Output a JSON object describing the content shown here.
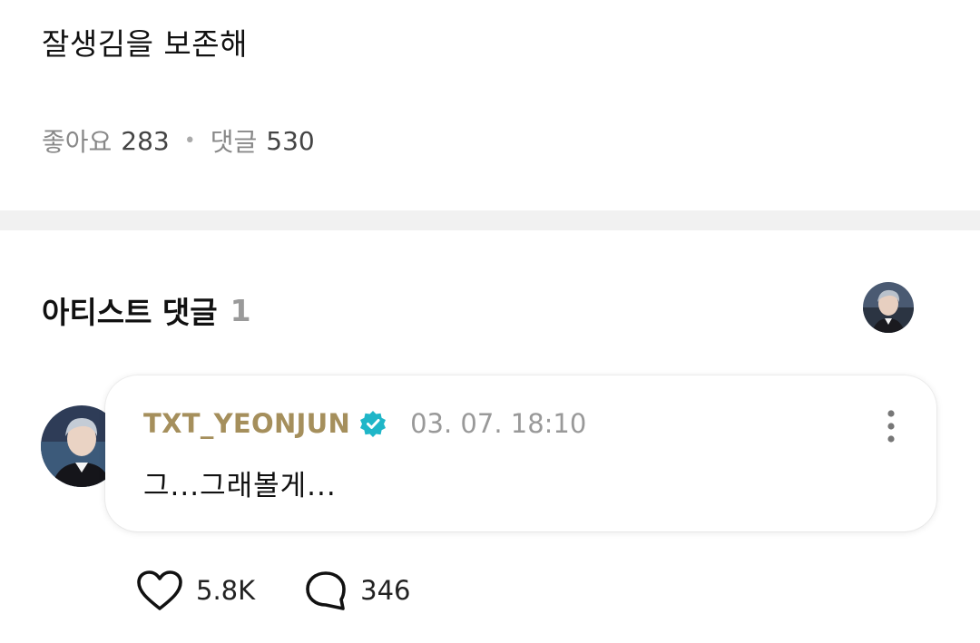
{
  "post": {
    "text": "잘생김을 보존해",
    "likes_label": "좋아요",
    "likes_count": "283",
    "comments_label": "댓글",
    "comments_count": "530"
  },
  "artist_comments": {
    "title": "아티스트 댓글",
    "count": "1"
  },
  "comment": {
    "author": "TXT_YEONJUN",
    "timestamp": "03. 07. 18:10",
    "text": "그...그래볼게...",
    "likes": "5.8K",
    "replies": "346"
  },
  "icons": {
    "verified": "verified-badge-icon",
    "more": "more-vertical-icon",
    "like": "heart-icon",
    "reply": "speech-bubble-icon"
  },
  "colors": {
    "author": "#a58f5c",
    "verified": "#1fb6c8",
    "divider": "#f1f1f1"
  }
}
